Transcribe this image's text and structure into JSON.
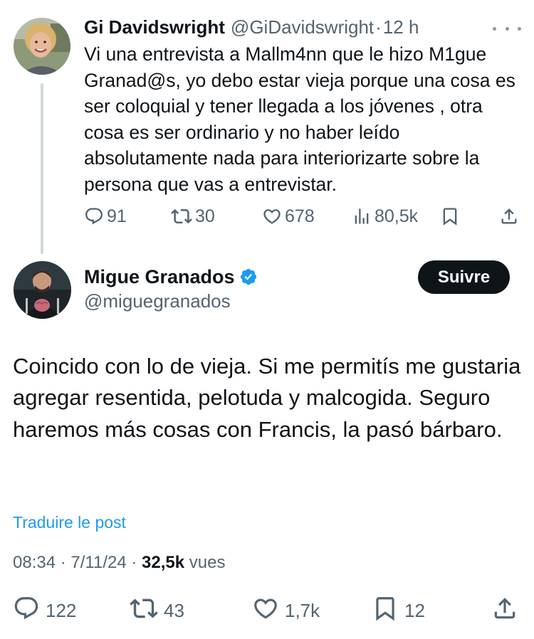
{
  "parent_tweet": {
    "author_name": "Gi Davidswright",
    "author_handle": "@GiDavidswright",
    "separator": "·",
    "time": "12 h",
    "text": "Vi una entrevista a Mallm4nn que le hizo M1gue Granad@s, yo debo estar vieja porque una cosa es ser coloquial y tener llegada a los jóvenes , otra cosa es ser ordinario y no haber leído absolutamente nada para interiorizarte sobre la persona que vas a entrevistar.",
    "more_icon": "ellipsis-icon",
    "stats": {
      "replies": "91",
      "reposts": "30",
      "likes": "678",
      "views": "80,5k"
    }
  },
  "main_tweet": {
    "author_name": "Migue Granados",
    "author_handle": "@miguegranados",
    "verified_icon": "verified-badge-icon",
    "follow_label": "Suivre",
    "text": "Coincido con lo de vieja. Si me permitís me gustaria agregar resentida, pelotuda y malcogida. Seguro haremos más cosas con Francis, la pasó bárbaro.",
    "translate_label": "Traduire le post",
    "time": "08:34",
    "dot1": "·",
    "date": "7/11/24",
    "dot2": "·",
    "views_count": "32,5k",
    "views_label": "vues",
    "stats": {
      "replies": "122",
      "reposts": "43",
      "likes": "1,7k",
      "bookmarks": "12"
    }
  },
  "colors": {
    "text_primary": "#0f1419",
    "text_secondary": "#536471",
    "link_blue": "#1d9bf0",
    "thread_line": "#cfd9de",
    "follow_bg": "#0f1419"
  }
}
